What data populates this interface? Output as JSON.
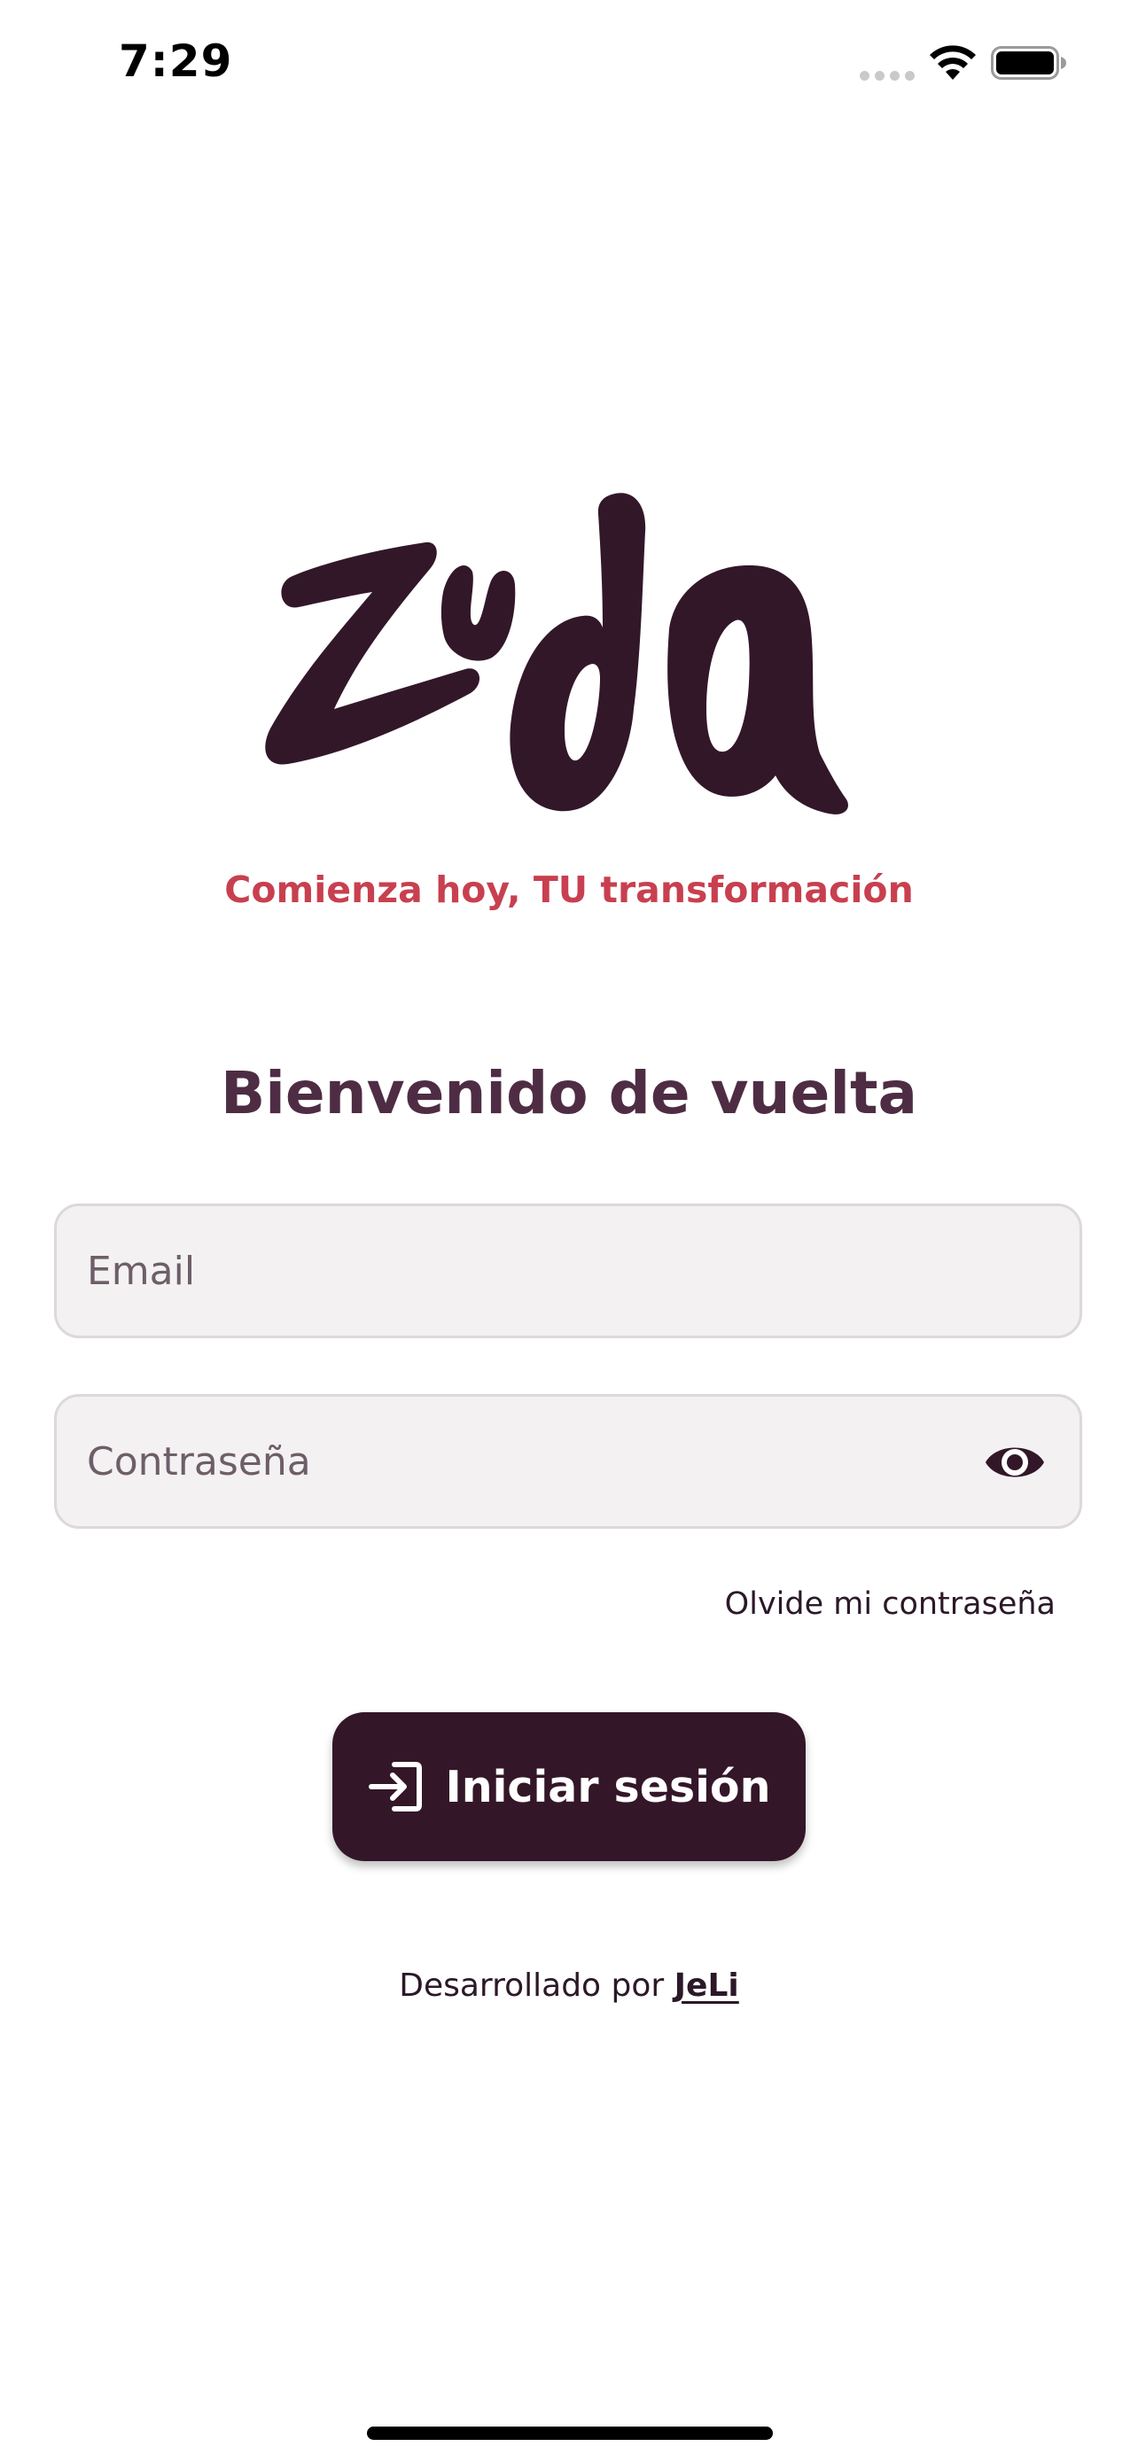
{
  "status_bar": {
    "time": "7:29",
    "icons": [
      "signal-dots-icon",
      "wifi-icon",
      "battery-icon"
    ]
  },
  "brand": {
    "logo_text": "zuda",
    "logo_color": "#321729",
    "tagline": "Comienza hoy, TU transformación",
    "tagline_color": "#c8404f"
  },
  "login": {
    "heading": "Bienvenido de vuelta",
    "email": {
      "placeholder": "Email",
      "value": ""
    },
    "password": {
      "placeholder": "Contraseña",
      "value": "",
      "toggle_icon": "eye-icon"
    },
    "forgot_password": "Olvide mi contraseña",
    "submit_label": "Iniciar sesión",
    "submit_icon": "login-icon",
    "button_color": "#341629"
  },
  "footer": {
    "prefix": "Desarrollado por",
    "link_label": "JeLi"
  }
}
